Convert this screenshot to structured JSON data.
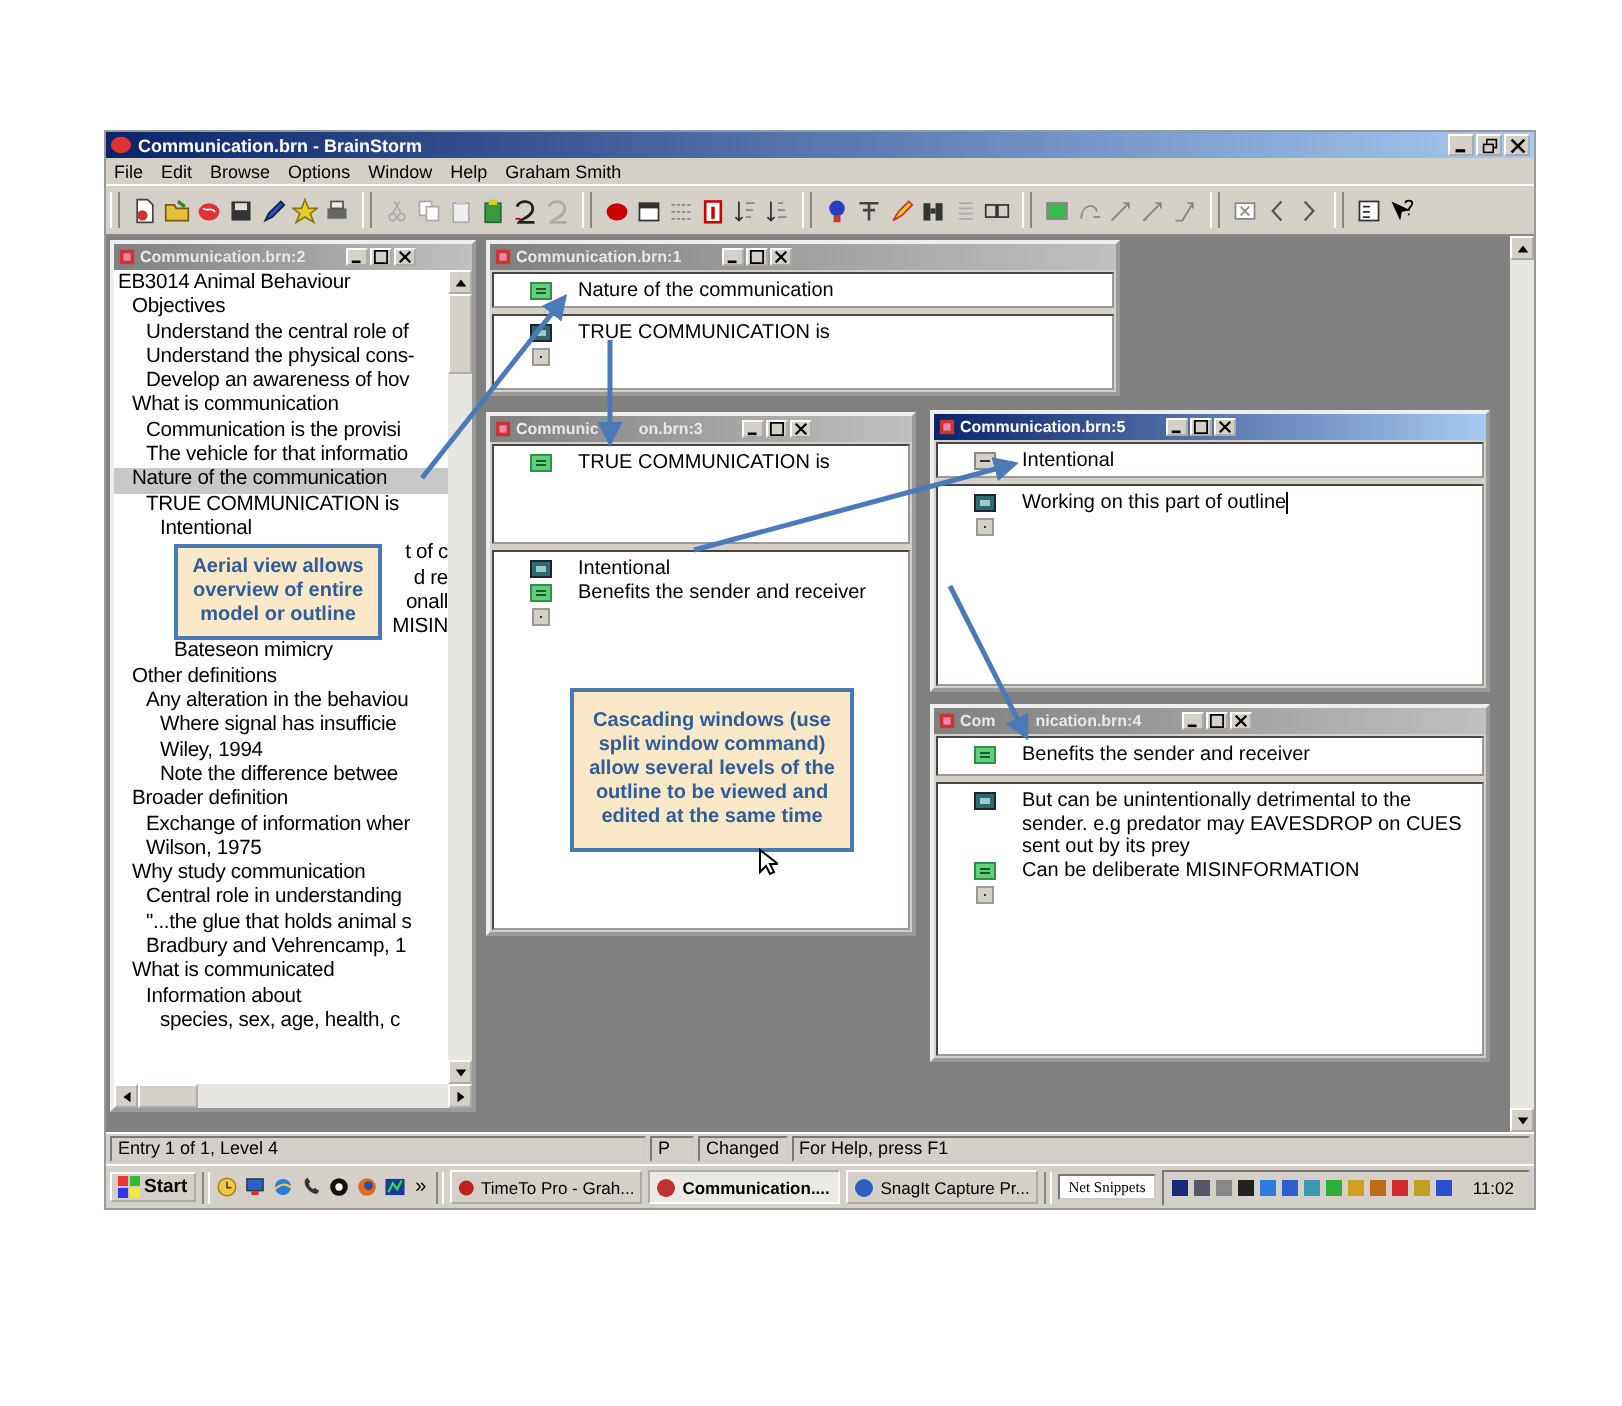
{
  "window": {
    "title": "Communication.brn - BrainStorm"
  },
  "menu": [
    "File",
    "Edit",
    "Browse",
    "Options",
    "Window",
    "Help",
    "Graham Smith"
  ],
  "outline_window": {
    "title": "Communication.brn:2",
    "items": [
      {
        "text": "EB3014 Animal Behaviour",
        "selected": false,
        "children": [
          {
            "text": "Objectives",
            "selected": false,
            "children": [
              {
                "text": "Understand the central role of",
                "selected": false
              },
              {
                "text": "Understand the physical cons-",
                "selected": false
              },
              {
                "text": "Develop an awareness of hov",
                "selected": false
              }
            ]
          },
          {
            "text": "What is communication",
            "selected": false,
            "children": [
              {
                "text": "Communication is the provisi",
                "selected": false
              },
              {
                "text": "The vehicle for that informatio",
                "selected": false
              }
            ]
          },
          {
            "text": "Nature of the communication",
            "selected": true,
            "children": [
              {
                "text": "TRUE COMMUNICATION is",
                "selected": false,
                "children": [
                  {
                    "text": "Intentional",
                    "selected": false,
                    "children": [
                      {
                        "text": "t of c",
                        "selected": false,
                        "covered": true
                      }
                    ]
                  },
                  {
                    "text": "d re",
                    "selected": false,
                    "covered": true
                  },
                  {
                    "text": "onall",
                    "selected": false,
                    "covered": true
                  },
                  {
                    "text": "MISIN",
                    "selected": false,
                    "covered": true,
                    "children": [
                      {
                        "text": "Bateseon mimicry",
                        "selected": false
                      }
                    ]
                  }
                ]
              }
            ]
          },
          {
            "text": "Other definitions",
            "selected": false,
            "children": [
              {
                "text": "Any alteration in the behaviou",
                "selected": false,
                "children": [
                  {
                    "text": "Where signal has insufficie",
                    "selected": false
                  },
                  {
                    "text": "Wiley, 1994",
                    "selected": false
                  },
                  {
                    "text": "Note the difference betwee",
                    "selected": false
                  }
                ]
              }
            ]
          },
          {
            "text": "Broader definition",
            "selected": false,
            "children": [
              {
                "text": "Exchange of information wher",
                "selected": false
              },
              {
                "text": "Wilson, 1975",
                "selected": false
              }
            ]
          },
          {
            "text": "Why study communication",
            "selected": false,
            "children": [
              {
                "text": "Central role in understanding",
                "selected": false
              },
              {
                "text": "\"...the glue that holds animal s",
                "selected": false
              },
              {
                "text": "Bradbury and Vehrencamp, 1",
                "selected": false
              }
            ]
          },
          {
            "text": "What is communicated",
            "selected": false,
            "children": [
              {
                "text": "Information about",
                "selected": false,
                "children": [
                  {
                    "text": "species, sex, age, health, c",
                    "selected": false
                  }
                ]
              }
            ]
          }
        ]
      }
    ]
  },
  "windows": [
    {
      "title": [
        "Communication.brn:1"
      ],
      "active": false,
      "heading": {
        "kind": "note",
        "text": "Nature of the communication"
      },
      "entries": [
        {
          "kind": "dark",
          "text": "TRUE COMMUNICATION is",
          "editing": false
        },
        {
          "kind": "blank",
          "editing": false
        }
      ]
    },
    {
      "title": [
        "Communic",
        "on.brn:3"
      ],
      "active": false,
      "heading": {
        "kind": "note",
        "text": "TRUE COMMUNICATION is"
      },
      "entries": [
        {
          "kind": "dark",
          "text": "Intentional",
          "editing": false
        },
        {
          "kind": "note",
          "text": "Benefits the sender and receiver",
          "editing": false
        },
        {
          "kind": "blank",
          "editing": false
        }
      ]
    },
    {
      "title": [
        "Communication.brn:5"
      ],
      "active": true,
      "heading": {
        "kind": "minus",
        "text": "Intentional"
      },
      "entries": [
        {
          "kind": "dark",
          "text": "Working on this part of outline",
          "editing": true
        },
        {
          "kind": "blank",
          "editing": false
        }
      ]
    },
    {
      "title": [
        "Com",
        "nication.brn:4"
      ],
      "active": false,
      "heading": {
        "kind": "note",
        "text": "Benefits the sender and receiver"
      },
      "entries": [
        {
          "kind": "dark",
          "text": "But can be unintentionally detrimental to the sender.  e.g predator may EAVESDROP on CUES sent out by its prey",
          "editing": false
        },
        {
          "kind": "note",
          "text": "Can be deliberate MISINFORMATION",
          "editing": false
        },
        {
          "kind": "blank",
          "editing": false
        }
      ]
    }
  ],
  "callouts": [
    "Aerial view allows overview of entire model or outline",
    "Cascading windows (use split window command) allow several levels of the outline to be viewed and edited at the same time"
  ],
  "status_bar": {
    "entry": "Entry 1 of 1, Level 4",
    "mode": "P",
    "changed": "Changed",
    "help": "For Help, press F1"
  },
  "taskbar": {
    "start": "Start",
    "more": "»",
    "tasks": [
      {
        "label": "TimeTo Pro - Grah...",
        "selected": false
      },
      {
        "label": "Communication....",
        "selected": true
      },
      {
        "label": "SnagIt Capture Pr...",
        "selected": false
      }
    ],
    "toolbar_label": "Net Snippets",
    "clock": "11:02"
  }
}
